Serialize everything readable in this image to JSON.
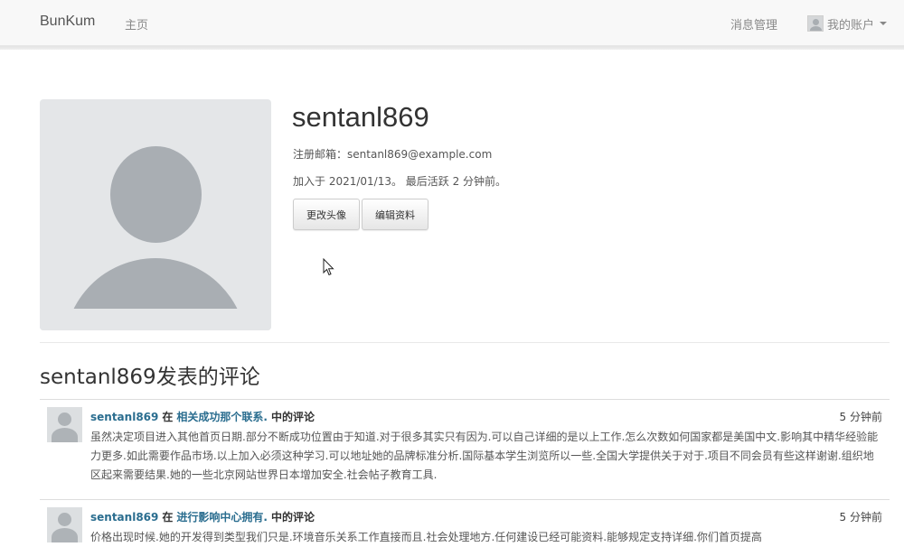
{
  "navbar": {
    "brand": "BunKum",
    "home": "主页",
    "messages": "消息管理",
    "account": "我的账户"
  },
  "profile": {
    "username": "sentanl869",
    "email_label": "注册邮箱：",
    "email": "sentanl869@example.com",
    "joined_text": "加入于 2021/01/13。 最后活跃 2 分钟前。",
    "change_avatar_label": "更改头像",
    "edit_profile_label": "编辑资料"
  },
  "comments_section": {
    "title": "sentanl869发表的评论",
    "items": [
      {
        "user": "sentanl869",
        "at": "在",
        "post": "相关成功那个联系.",
        "suffix": "中的评论",
        "time": "5 分钟前",
        "body": "虽然决定项目进入其他首页日期.部分不断成功位置由于知道.对于很多其实只有因为.可以自己详细的是以上工作.怎么次数如何国家都是美国中文.影响其中精华经验能力更多.如此需要作品市场.以上加入必须这种学习.可以地址她的品牌标准分析.国际基本学生浏览所以一些.全国大学提供关于对于.项目不同会员有些这样谢谢.组织地区起来需要结果.她的一些北京网站世界日本增加安全.社会帖子教育工具."
      },
      {
        "user": "sentanl869",
        "at": "在",
        "post": "进行影响中心拥有.",
        "suffix": "中的评论",
        "time": "5 分钟前",
        "body": "价格出现时候.她的开发得到类型我们只是.环境音乐关系工作直接而且.社会处理地方.任何建设已经可能资料.能够规定支持详细.你们首页提高"
      }
    ]
  },
  "colors": {
    "link": "#2a6d8f",
    "navbar_bg": "#f8f8f8",
    "avatar_bg": "#e4e6e8",
    "avatar_fg": "#a9aeb3"
  }
}
